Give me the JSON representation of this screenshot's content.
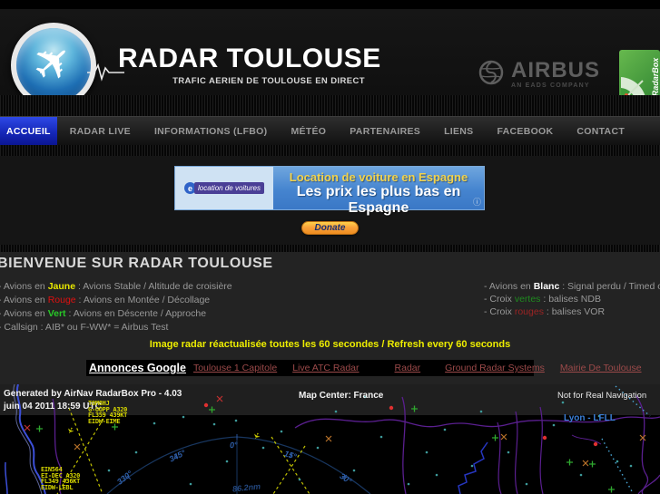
{
  "header": {
    "title": "RADAR TOULOUSE",
    "subtitle": "TRAFIC AERIEN DE TOULOUSE EN DIRECT",
    "airbus_label": "AIRBUS",
    "airbus_sub": "AN EADS COMPANY",
    "radarbox_label": "RadarBox"
  },
  "nav": {
    "items": [
      {
        "label": "ACCUEIL"
      },
      {
        "label": "RADAR LIVE"
      },
      {
        "label": "INFORMATIONS (LFBO)"
      },
      {
        "label": "MÉTÉO"
      },
      {
        "label": "PARTENAIRES"
      },
      {
        "label": "LIENS"
      },
      {
        "label": "FACEBOOK"
      },
      {
        "label": "CONTACT"
      }
    ]
  },
  "ad_banner": {
    "logo_e": "e",
    "logo_text": "location de voitures",
    "line1": "Location de voiture en Espagne",
    "line2": "Les prix les plus bas en Espagne",
    "info_icon": "ⓘ"
  },
  "donate": {
    "label": "Donate"
  },
  "welcome": {
    "heading": "BIENVENUE SUR RADAR TOULOUSE",
    "left": [
      {
        "pre": "- Avions en ",
        "word": "Jaune",
        "rest": " : Avions Stable / Altitude de croisière"
      },
      {
        "pre": "- Avions en ",
        "word": "Rouge",
        "rest": " : Avions en Montée / Décollage"
      },
      {
        "pre": "- Avions en ",
        "word": "Vert",
        "rest": "  : Avions en Déscente / Approche"
      },
      {
        "pre": "- Callsign : AIB* ou F-WW* = Airbus Test",
        "word": "",
        "rest": ""
      }
    ],
    "right": [
      {
        "pre": "- Avions en ",
        "word": "Blanc",
        "rest": " : Signal perdu / Timed out"
      },
      {
        "pre": "- Croix ",
        "word": "vertes",
        "rest": " : balises NDB"
      },
      {
        "pre": "- Croix ",
        "word": "rouges",
        "rest": " : balises VOR"
      }
    ],
    "refresh_notice": "Image radar réactualisée toutes les 60 secondes / Refresh every 60 seconds"
  },
  "ads_bar": {
    "title": "Annonces Google",
    "links": [
      "Toulouse 1 Capitole",
      "Live ATC Radar",
      "Radar",
      "Ground Radar Systems",
      "Mairie De Toulouse"
    ]
  },
  "map": {
    "generated": "Generated by AirNav RadarBox Pro - 4.03",
    "datetime": "juin 04 2011 18:59 UTC",
    "map_center": "Map Center: France",
    "disclaimer": "Not for Real Navigation",
    "city_label": "Lyon - LFLL",
    "range_label": "86.2nm",
    "compass_labels": [
      "330°",
      "345°",
      "0°",
      "15°",
      "30°"
    ],
    "aircraft": [
      {
        "callsign": "TOM8HJ",
        "reg_type": "G-OOPP A320",
        "fl_speed": "FL359 439KT",
        "route": "EIDW-EIME"
      },
      {
        "callsign": "EIN564",
        "reg_type": "EI-DEC A320",
        "fl_speed": "FL349 436KT",
        "route": "EIDW-LEBL"
      }
    ]
  }
}
